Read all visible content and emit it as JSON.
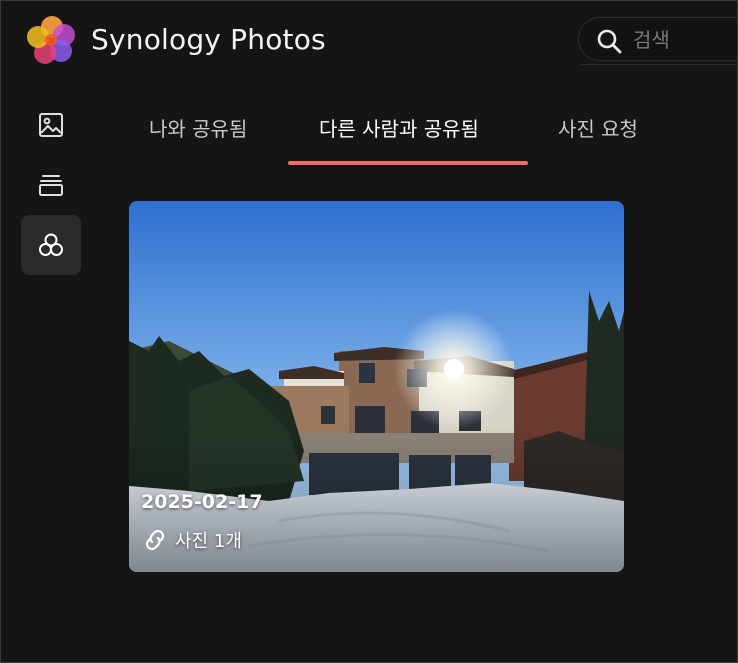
{
  "header": {
    "app_title": "Synology Photos",
    "logo_icon": "synology-photos-flower-logo",
    "search": {
      "placeholder": "검색",
      "value": "",
      "icon": "search-icon"
    }
  },
  "sidebar": {
    "items": [
      {
        "icon": "photo-icon",
        "active": false
      },
      {
        "icon": "albums-icon",
        "active": false
      },
      {
        "icon": "sharing-icon",
        "active": true
      }
    ]
  },
  "tabs": [
    {
      "label": "나와 공유됨",
      "active": false
    },
    {
      "label": "다른 사람과 공유됨",
      "active": true
    },
    {
      "label": "사진 요청",
      "active": false
    }
  ],
  "accent_color": "#f06a6a",
  "shared_items": [
    {
      "date": "2025-02-17",
      "count_label": "사진 1개",
      "icon": "share-link-icon"
    }
  ]
}
